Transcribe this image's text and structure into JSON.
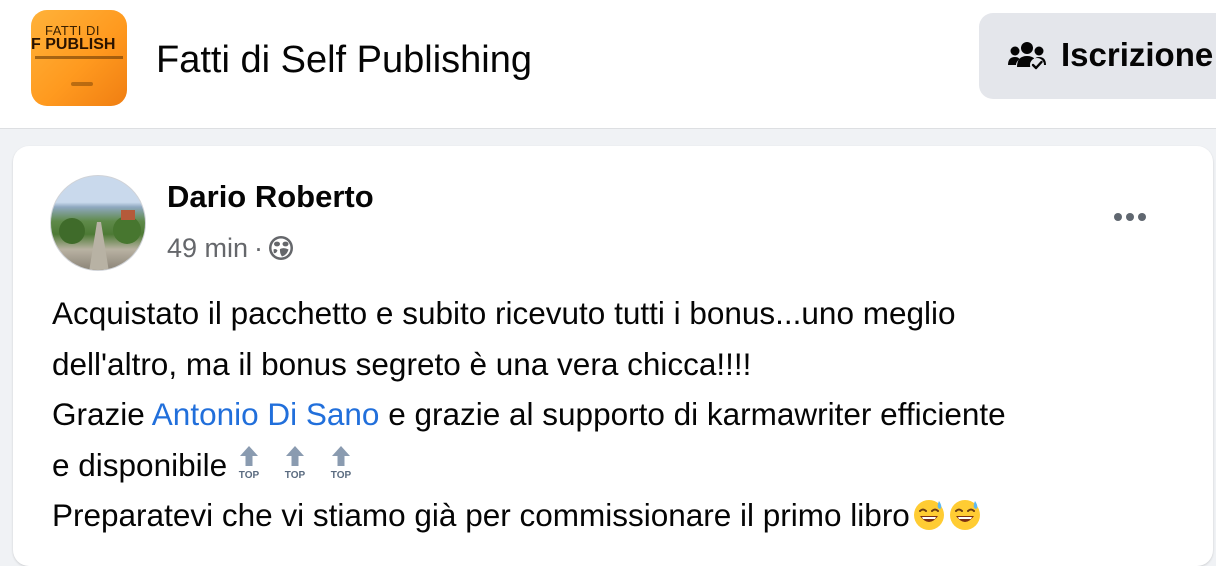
{
  "group": {
    "logo_text_line1": "FATTI DI",
    "logo_text_line2": "F PUBLISH",
    "name": "Fatti di Self Publishing",
    "join_button_label": "Iscrizione"
  },
  "post": {
    "author": "Dario Roberto",
    "time": "49 min",
    "separator": "·",
    "audience_icon": "globe-icon",
    "text": {
      "line1": "Acquistato il pacchetto e subito ricevuto tutti i bonus...uno meglio",
      "line2": "dell'altro, ma il bonus segreto è una vera chicca!!!!",
      "line3_before": "Grazie ",
      "mention": "Antonio Di Sano",
      "line3_after": " e grazie al supporto di karmawriter efficiente",
      "line4": "e disponibile ",
      "line5": "Preparatevi che vi stiamo già per commissionare il primo libro"
    },
    "emoji": {
      "top_label": "TOP",
      "top_count": 3,
      "sweat_smile_count": 2
    }
  },
  "colors": {
    "mention": "#216fdb",
    "meta": "#65676b",
    "button_bg": "#e4e6eb",
    "logo_orange": "#ff9a1f"
  }
}
